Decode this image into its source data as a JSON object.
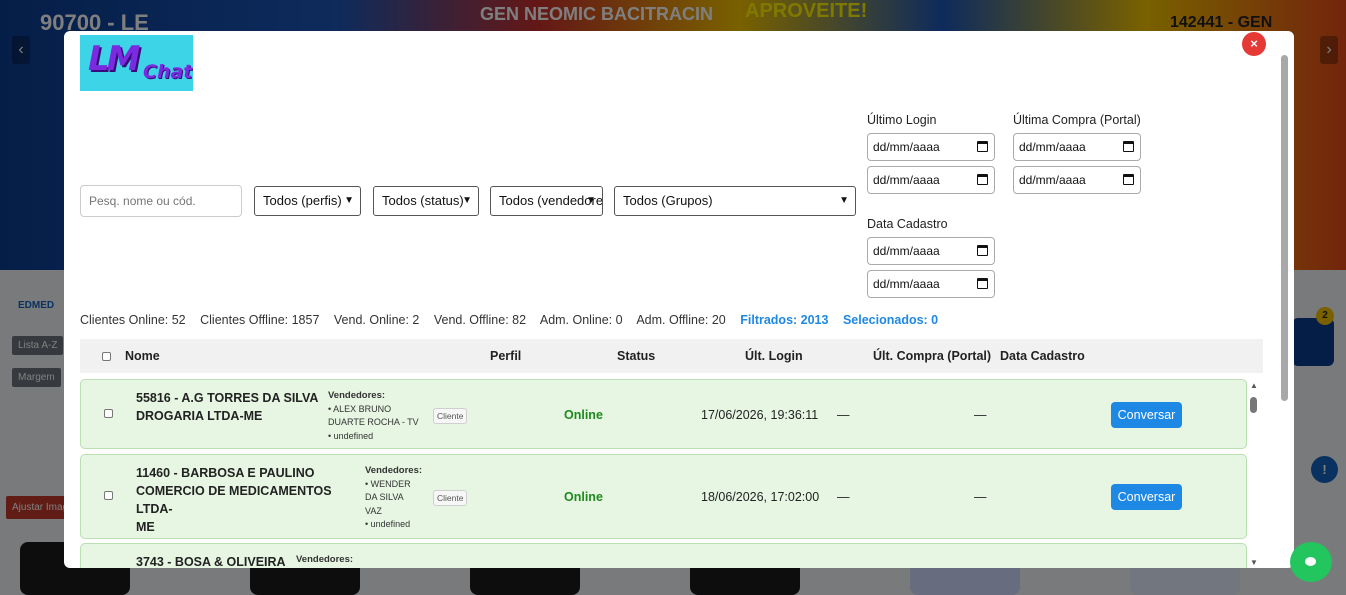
{
  "background": {
    "banner": {
      "texts": [
        "90700 - LE",
        "GEN NEOMIC BACITRACIN",
        "APROVEITE!",
        "142441 - GEN"
      ],
      "arrow_left": "‹",
      "arrow_right": "›"
    },
    "brand_short": "EDMED",
    "buttons": [
      "Lista A-Z",
      "Margem"
    ],
    "red_button": "Ajustar Imagens",
    "cart_count": "2",
    "info_icon_label": "!"
  },
  "modal": {
    "close_label": "×",
    "logo": {
      "line1": "LM",
      "line2": "Chat"
    },
    "filters": {
      "search_placeholder": "Pesq. nome ou cód.",
      "perfis": "Todos (perfis)",
      "status": "Todos (status)",
      "vendedores": "Todos (vendedores)",
      "grupos": "Todos (Grupos)"
    },
    "date_filters": {
      "ultimo_login": {
        "label": "Último Login",
        "from": "dd/mm/aaaa",
        "to": "dd/mm/aaaa"
      },
      "ultima_compra": {
        "label": "Última Compra (Portal)",
        "from": "dd/mm/aaaa",
        "to": "dd/mm/aaaa"
      },
      "data_cadastro": {
        "label": "Data Cadastro",
        "from": "dd/mm/aaaa",
        "to": "dd/mm/aaaa"
      }
    },
    "stats": {
      "clientes_online": "Clientes Online: 52",
      "clientes_offline": "Clientes Offline: 1857",
      "vend_online": "Vend. Online: 2",
      "vend_offline": "Vend. Offline: 82",
      "adm_online": "Adm. Online: 0",
      "adm_offline": "Adm. Offline: 20",
      "filtrados": "Filtrados: 2013",
      "selecionados": "Selecionados: 0"
    },
    "table": {
      "headers": {
        "nome": "Nome",
        "perfil": "Perfil",
        "status": "Status",
        "ult_login": "Últ. Login",
        "ult_compra": "Últ. Compra (Portal)",
        "data_cadastro": "Data Cadastro"
      },
      "rows": [
        {
          "name": [
            "55816 - A.G TORRES DA SILVA",
            "DROGARIA LTDA-ME"
          ],
          "vendedores_label": "Vendedores:",
          "vendedores": [
            "• ALEX BRUNO",
            "DUARTE ROCHA - TV",
            "• undefined"
          ],
          "perfil": "Cliente",
          "status": "Online",
          "ult_login": "17/06/2026, 19:36:11",
          "ult_compra": "—",
          "data_cadastro": "—",
          "action": "Conversar"
        },
        {
          "name": [
            "11460 - BARBOSA E PAULINO",
            "COMERCIO DE MEDICAMENTOS LTDA-",
            "ME"
          ],
          "vendedores_label": "Vendedores:",
          "vendedores": [
            "• WENDER",
            "DA SILVA",
            "VAZ",
            "• undefined"
          ],
          "perfil": "Cliente",
          "status": "Online",
          "ult_login": "18/06/2026, 17:02:00",
          "ult_compra": "—",
          "data_cadastro": "—",
          "action": "Conversar"
        },
        {
          "name": [
            "3743 - BOSA & OLIVEIRA"
          ],
          "vendedores_label": "Vendedores:"
        }
      ]
    },
    "scroll_up": "▲",
    "scroll_down": "▼"
  },
  "colors": {
    "accent": "#1e88e5",
    "online": "#1e8a1e",
    "row_bg": "#e6f6e2",
    "close": "#e53935",
    "chat": "#22c55e"
  }
}
